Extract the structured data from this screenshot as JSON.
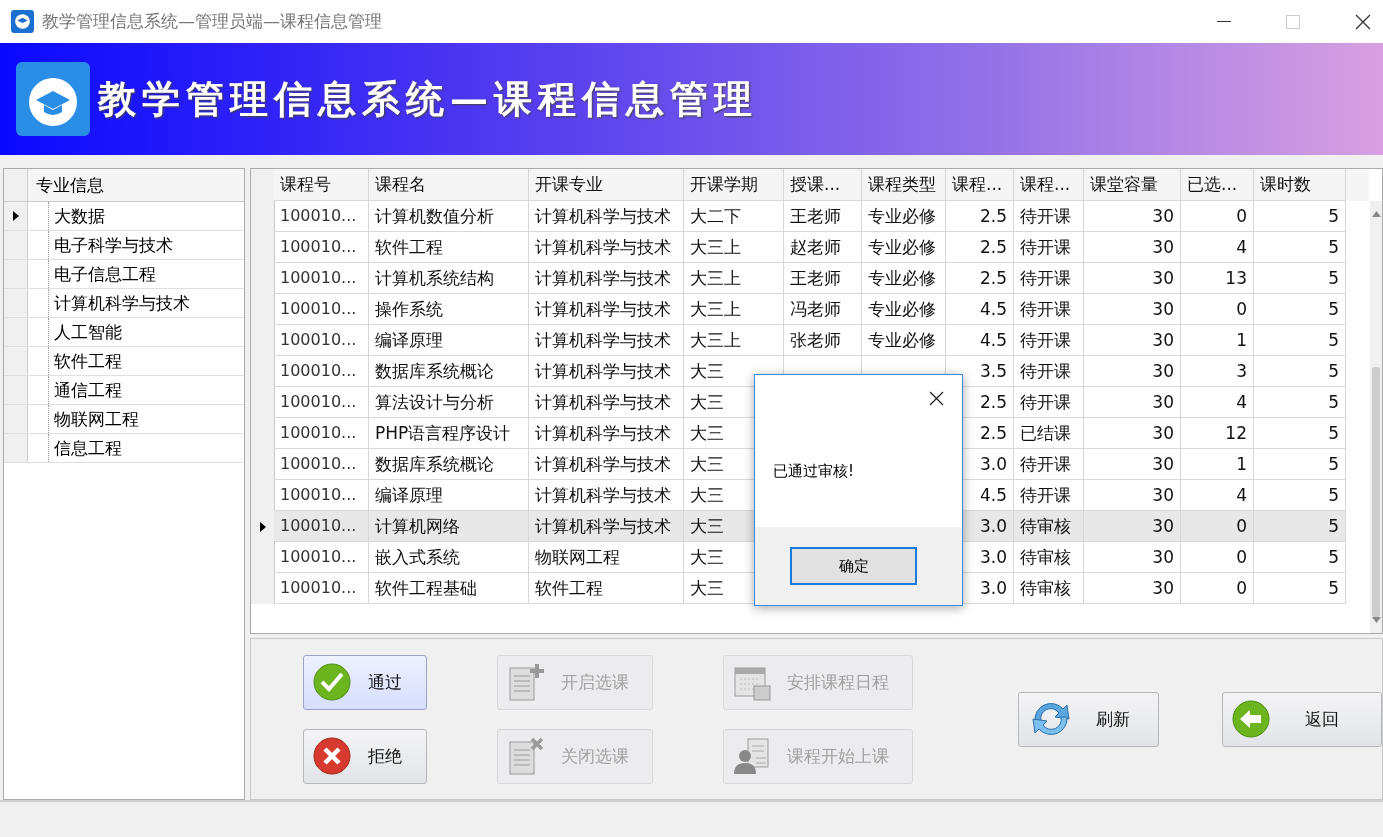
{
  "window": {
    "title": "教学管理信息系统—管理员端—课程信息管理"
  },
  "banner": {
    "title": "教学管理信息系统—课程信息管理"
  },
  "majors": {
    "header": "专业信息",
    "items": [
      {
        "label": "大数据",
        "selected": true
      },
      {
        "label": "电子科学与技术",
        "selected": false
      },
      {
        "label": "电子信息工程",
        "selected": false
      },
      {
        "label": "计算机科学与技术",
        "selected": false
      },
      {
        "label": "人工智能",
        "selected": false
      },
      {
        "label": "软件工程",
        "selected": false
      },
      {
        "label": "通信工程",
        "selected": false
      },
      {
        "label": "物联网工程",
        "selected": false
      },
      {
        "label": "信息工程",
        "selected": false
      }
    ]
  },
  "courses": {
    "columns": [
      "课程号",
      "课程名",
      "开课专业",
      "开课学期",
      "授课...",
      "课程类型",
      "课程...",
      "课程...",
      "课堂容量",
      "已选...",
      "课时数"
    ],
    "rows": [
      {
        "selected": false,
        "id": "100010...",
        "name": "计算机数值分析",
        "major": "计算机科学与技术",
        "semester": "大二下",
        "teacher": "王老师",
        "type": "专业必修",
        "credit": "2.5",
        "status": "待开课",
        "capacity": "30",
        "enrolled": "0",
        "hours": "5"
      },
      {
        "selected": false,
        "id": "100010...",
        "name": "软件工程",
        "major": "计算机科学与技术",
        "semester": "大三上",
        "teacher": "赵老师",
        "type": "专业必修",
        "credit": "2.5",
        "status": "待开课",
        "capacity": "30",
        "enrolled": "4",
        "hours": "5"
      },
      {
        "selected": false,
        "id": "100010...",
        "name": "计算机系统结构",
        "major": "计算机科学与技术",
        "semester": "大三上",
        "teacher": "王老师",
        "type": "专业必修",
        "credit": "2.5",
        "status": "待开课",
        "capacity": "30",
        "enrolled": "13",
        "hours": "5"
      },
      {
        "selected": false,
        "id": "100010...",
        "name": "操作系统",
        "major": "计算机科学与技术",
        "semester": "大三上",
        "teacher": "冯老师",
        "type": "专业必修",
        "credit": "4.5",
        "status": "待开课",
        "capacity": "30",
        "enrolled": "0",
        "hours": "5"
      },
      {
        "selected": false,
        "id": "100010...",
        "name": "编译原理",
        "major": "计算机科学与技术",
        "semester": "大三上",
        "teacher": "张老师",
        "type": "专业必修",
        "credit": "4.5",
        "status": "待开课",
        "capacity": "30",
        "enrolled": "1",
        "hours": "5"
      },
      {
        "selected": false,
        "id": "100010...",
        "name": "数据库系统概论",
        "major": "计算机科学与技术",
        "semester": "大三",
        "credit": "3.5",
        "status": "待开课",
        "capacity": "30",
        "enrolled": "3",
        "hours": "5"
      },
      {
        "selected": false,
        "id": "100010...",
        "name": "算法设计与分析",
        "major": "计算机科学与技术",
        "semester": "大三",
        "credit": "2.5",
        "status": "待开课",
        "capacity": "30",
        "enrolled": "4",
        "hours": "5"
      },
      {
        "selected": false,
        "id": "100010...",
        "name": "PHP语言程序设计",
        "major": "计算机科学与技术",
        "semester": "大三",
        "credit": "2.5",
        "status": "已结课",
        "capacity": "30",
        "enrolled": "12",
        "hours": "5"
      },
      {
        "selected": false,
        "id": "100010...",
        "name": "数据库系统概论",
        "major": "计算机科学与技术",
        "semester": "大三",
        "credit": "3.0",
        "status": "待开课",
        "capacity": "30",
        "enrolled": "1",
        "hours": "5"
      },
      {
        "selected": false,
        "id": "100010...",
        "name": "编译原理",
        "major": "计算机科学与技术",
        "semester": "大三",
        "credit": "4.5",
        "status": "待开课",
        "capacity": "30",
        "enrolled": "4",
        "hours": "5"
      },
      {
        "selected": true,
        "id": "100010...",
        "name": "计算机网络",
        "major": "计算机科学与技术",
        "semester": "大三",
        "credit": "3.0",
        "status": "待审核",
        "capacity": "30",
        "enrolled": "0",
        "hours": "5"
      },
      {
        "selected": false,
        "id": "100010...",
        "name": "嵌入式系统",
        "major": "物联网工程",
        "semester": "大三",
        "credit": "3.0",
        "status": "待审核",
        "capacity": "30",
        "enrolled": "0",
        "hours": "5"
      },
      {
        "selected": false,
        "id": "100010...",
        "name": "软件工程基础",
        "major": "软件工程",
        "semester": "大三",
        "credit": "3.0",
        "status": "待审核",
        "capacity": "30",
        "enrolled": "0",
        "hours": "5"
      }
    ]
  },
  "actions": [
    {
      "label": "通过",
      "disabled": false
    },
    {
      "label": "拒绝",
      "disabled": false
    },
    {
      "label": "开启选课",
      "disabled": true
    },
    {
      "label": "关闭选课",
      "disabled": true
    },
    {
      "label": "安排课程日程",
      "disabled": true
    },
    {
      "label": "课程开始上课",
      "disabled": true
    },
    {
      "label": "刷新",
      "disabled": false
    },
    {
      "label": "返回",
      "disabled": false
    }
  ],
  "dialog": {
    "message": "已通过审核!",
    "button": "确定"
  }
}
